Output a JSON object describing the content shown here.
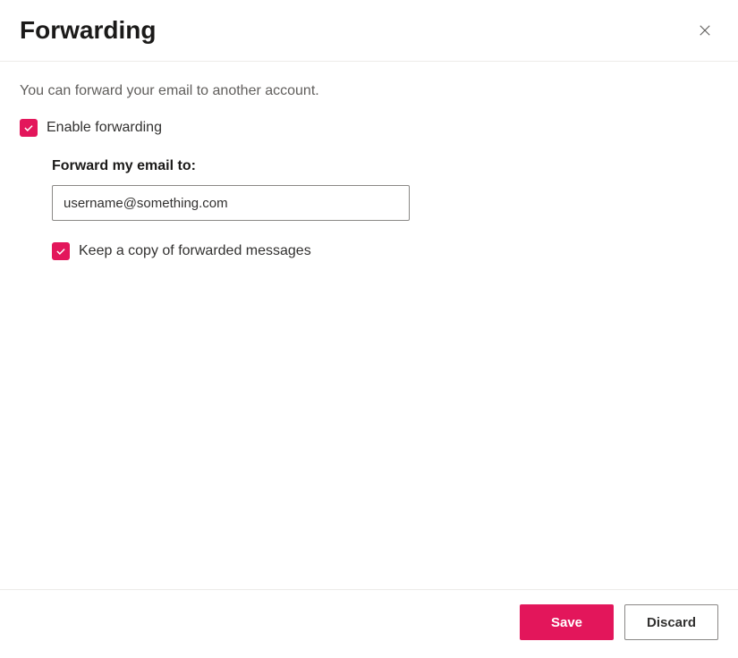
{
  "header": {
    "title": "Forwarding"
  },
  "content": {
    "description": "You can forward your email to another account.",
    "enable_forwarding_label": "Enable forwarding",
    "enable_forwarding_checked": true,
    "forward_to_label": "Forward my email to:",
    "forward_to_value": "username@something.com",
    "keep_copy_label": "Keep a copy of forwarded messages",
    "keep_copy_checked": true
  },
  "footer": {
    "save_label": "Save",
    "discard_label": "Discard"
  },
  "colors": {
    "accent": "#e3165b"
  }
}
